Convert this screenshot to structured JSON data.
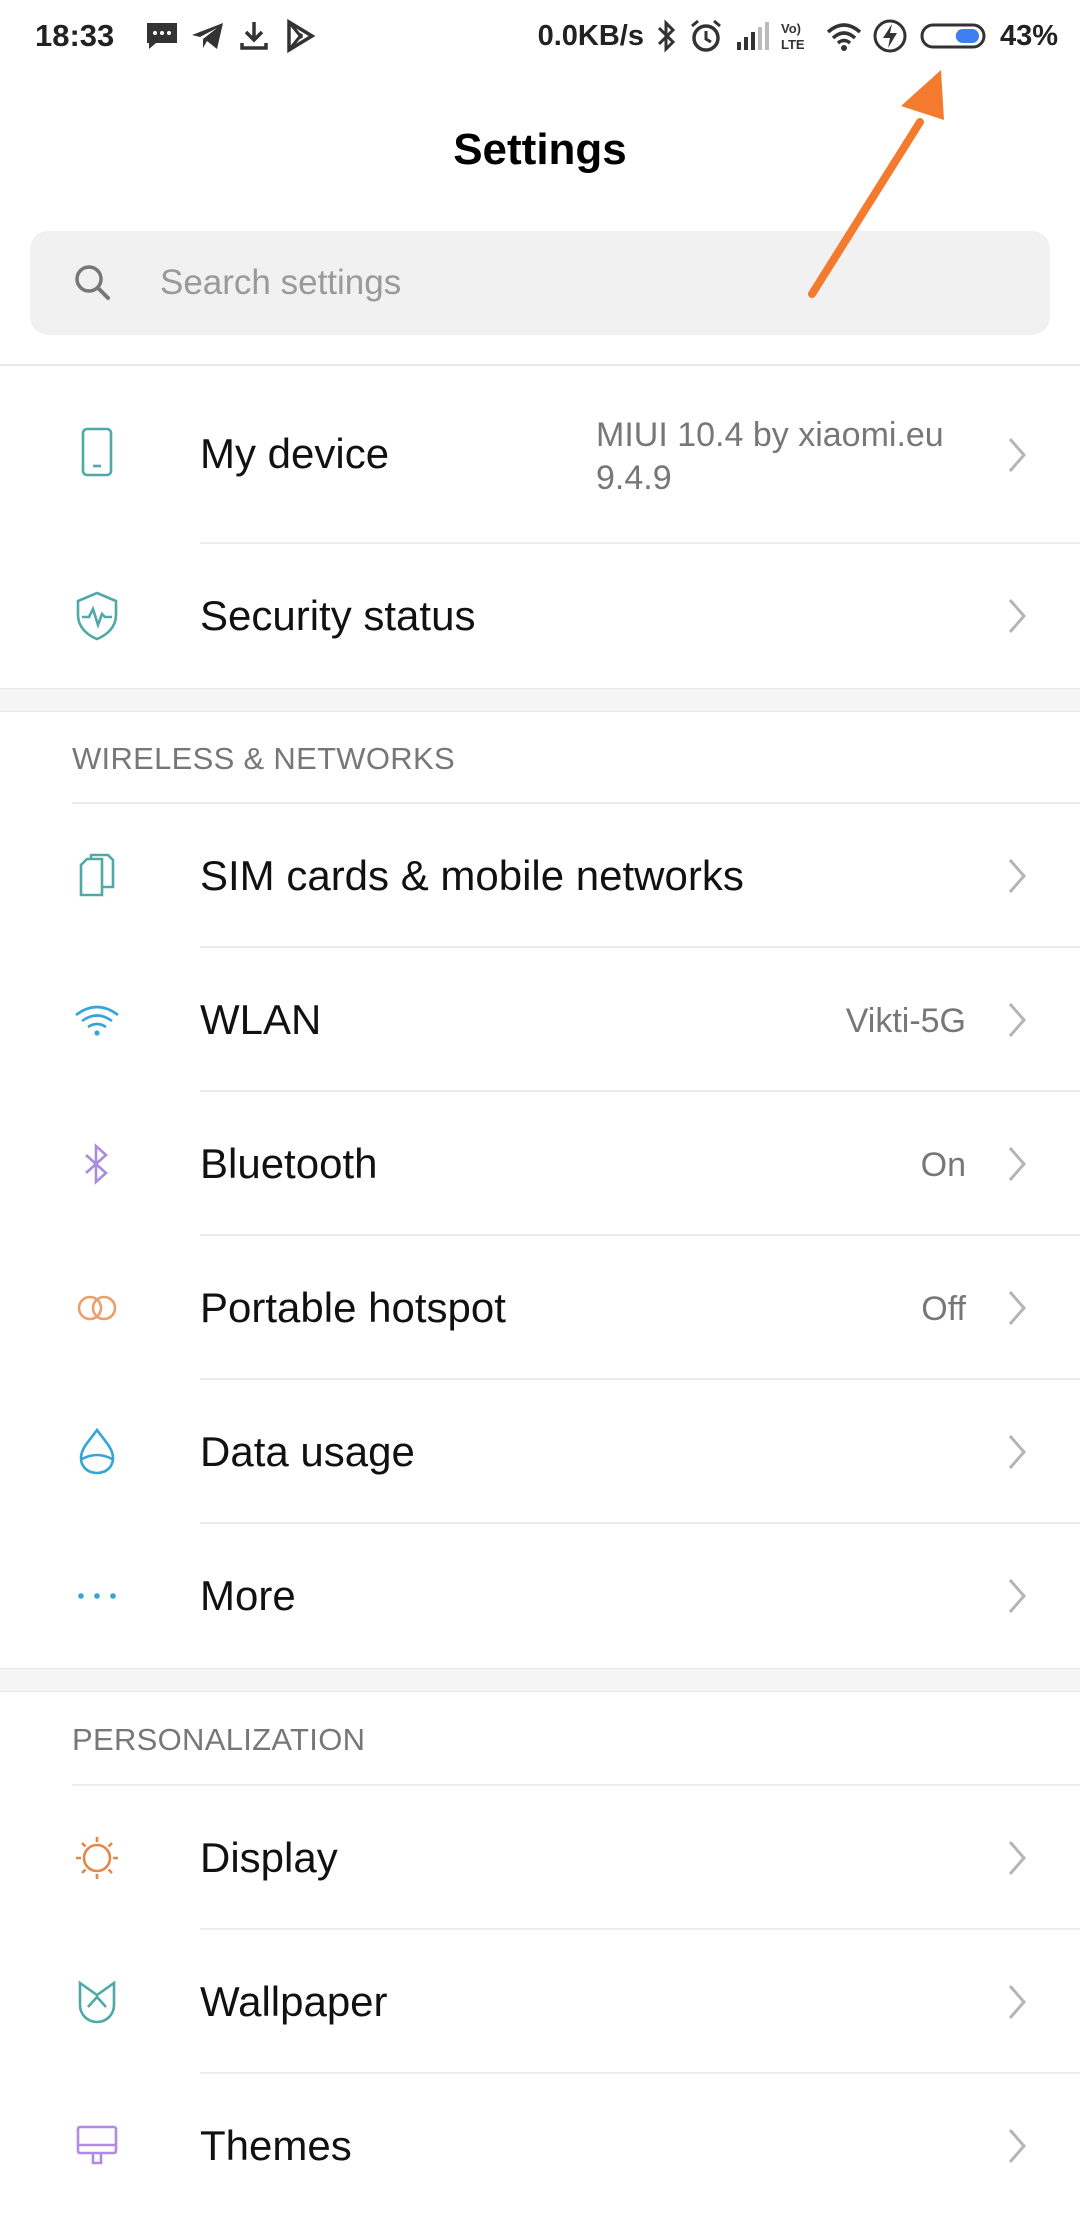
{
  "status_bar": {
    "time": "18:33",
    "network_speed": "0.0KB/s",
    "battery_percent": "43%",
    "battery_level": 0.43,
    "left_icons": [
      "message-icon",
      "telegram-icon",
      "download-icon",
      "play-store-icon"
    ],
    "right_icons": [
      "bluetooth-icon",
      "alarm-icon",
      "signal-icon",
      "volte-icon",
      "wifi-icon",
      "charging-icon",
      "battery-icon"
    ]
  },
  "header": {
    "title": "Settings"
  },
  "search": {
    "placeholder": "Search settings"
  },
  "top_items": [
    {
      "label": "My device",
      "value_line1": "MIUI 10.4 by xiaomi.eu",
      "value_line2": "9.4.9",
      "icon": "phone-icon"
    },
    {
      "label": "Security status",
      "value": "",
      "icon": "shield-icon"
    }
  ],
  "wireless": {
    "header": "WIRELESS & NETWORKS",
    "items": [
      {
        "label": "SIM cards & mobile networks",
        "value": "",
        "icon": "sim-cards-icon"
      },
      {
        "label": "WLAN",
        "value": "Vikti-5G",
        "icon": "wifi-icon"
      },
      {
        "label": "Bluetooth",
        "value": "On",
        "icon": "bluetooth-icon"
      },
      {
        "label": "Portable hotspot",
        "value": "Off",
        "icon": "hotspot-icon"
      },
      {
        "label": "Data usage",
        "value": "",
        "icon": "data-drop-icon"
      },
      {
        "label": "More",
        "value": "",
        "icon": "more-dots-icon"
      }
    ]
  },
  "personalization": {
    "header": "PERSONALIZATION",
    "items": [
      {
        "label": "Display",
        "value": "",
        "icon": "display-sun-icon"
      },
      {
        "label": "Wallpaper",
        "value": "",
        "icon": "wallpaper-icon"
      },
      {
        "label": "Themes",
        "value": "",
        "icon": "themes-icon"
      }
    ]
  },
  "colors": {
    "annotation_arrow": "#f47a2e",
    "battery_fill": "#3d7ff0",
    "teal_icon": "#4fa9a6",
    "wifi_icon": "#35a5d8",
    "bluetooth_icon": "#a98be0",
    "orange_icon": "#e9a06a",
    "display_icon": "#e2884a",
    "themes_icon": "#b08be0"
  }
}
